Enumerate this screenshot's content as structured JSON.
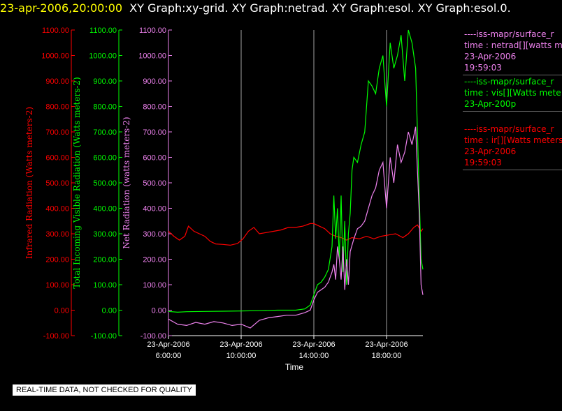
{
  "header": {
    "date_time": "23-apr-2006,20:00:00",
    "graphs": "XY Graph:xy-grid.  XY Graph:netrad.  XY Graph:esol.  XY Graph:esol.0."
  },
  "footer": {
    "disclaimer": "REAL-TIME DATA, NOT CHECKED FOR QUALITY"
  },
  "legend": [
    {
      "lines": [
        "----iss-mapr/surface_r",
        "time : netrad[][watts m",
        "23-Apr-2006",
        "19:59:03"
      ],
      "color": "#ee82ee"
    },
    {
      "lines": [
        "----iss-mapr/surface_r",
        "time : vis[][Watts mete",
        "23-Apr-200p"
      ],
      "color": "#00ff00"
    },
    {
      "lines": [
        "----iss-mapr/surface_r",
        "time : ir[][Watts meters",
        "23-Apr-2006",
        "19:59:03"
      ],
      "color": "#ff0000"
    }
  ],
  "chart_data": {
    "type": "line",
    "title": "",
    "xlabel": "Time",
    "x_ticks": [
      {
        "hour": 6,
        "line1": "23-Apr-2006",
        "line2": "6:00:00"
      },
      {
        "hour": 10,
        "line1": "23-Apr-2006",
        "line2": "10:00:00"
      },
      {
        "hour": 14,
        "line1": "23-Apr-2006",
        "line2": "14:00:00"
      },
      {
        "hour": 18,
        "line1": "23-Apr-2006",
        "line2": "18:00:00"
      }
    ],
    "x_range_hours": [
      6,
      20
    ],
    "y_axes": [
      {
        "id": "ir",
        "label": "Infrared Radiation (Watts meters-2)",
        "color": "#ff0000",
        "ylim": [
          -100,
          1100
        ]
      },
      {
        "id": "vis",
        "label": "Total Incoming Visible Radiation (Watts meters-2)",
        "color": "#00ff00",
        "ylim": [
          -100,
          1100
        ]
      },
      {
        "id": "net",
        "label": "Net Radiation (watts meters-2)",
        "color": "#ee82ee",
        "ylim": [
          -100,
          1100
        ]
      }
    ],
    "y_ticks": [
      "-100.00",
      "0.00",
      "100.00",
      "200.00",
      "300.00",
      "400.00",
      "500.00",
      "600.00",
      "700.00",
      "800.00",
      "900.00",
      "1000.00",
      "1100.00"
    ],
    "grid": "vertical",
    "series": [
      {
        "name": "ir",
        "color": "#ff0000",
        "x": [
          6.0,
          6.3,
          6.6,
          6.9,
          7.1,
          7.4,
          7.7,
          8.0,
          8.3,
          8.6,
          9.0,
          9.4,
          9.8,
          10.1,
          10.4,
          10.7,
          11.0,
          11.4,
          11.8,
          12.2,
          12.6,
          13.0,
          13.4,
          13.8,
          14.0,
          14.3,
          14.6,
          14.9,
          15.2,
          15.5,
          15.8,
          16.1,
          16.5,
          16.9,
          17.3,
          17.7,
          18.1,
          18.5,
          18.9,
          19.2,
          19.5,
          19.7,
          19.9,
          20.0
        ],
        "y": [
          310,
          290,
          275,
          290,
          330,
          310,
          300,
          290,
          270,
          260,
          258,
          255,
          262,
          280,
          310,
          325,
          300,
          305,
          310,
          315,
          325,
          325,
          330,
          340,
          340,
          330,
          320,
          300,
          290,
          285,
          275,
          285,
          280,
          290,
          280,
          290,
          295,
          300,
          285,
          300,
          325,
          335,
          310,
          320
        ]
      },
      {
        "name": "vis",
        "color": "#00ff00",
        "x": [
          6.0,
          6.5,
          7.0,
          8.0,
          9.0,
          10.0,
          11.0,
          12.0,
          13.0,
          13.5,
          13.8,
          14.0,
          14.2,
          14.4,
          14.6,
          14.8,
          15.0,
          15.1,
          15.2,
          15.3,
          15.4,
          15.5,
          15.6,
          15.7,
          15.8,
          15.9,
          16.0,
          16.1,
          16.2,
          16.4,
          16.6,
          16.8,
          17.0,
          17.2,
          17.4,
          17.6,
          17.8,
          18.0,
          18.2,
          18.4,
          18.6,
          18.8,
          19.0,
          19.2,
          19.4,
          19.6,
          19.8,
          19.9,
          20.0
        ],
        "y": [
          -5,
          -8,
          -6,
          -5,
          -4,
          -3,
          -2,
          0,
          0,
          5,
          20,
          60,
          100,
          110,
          130,
          160,
          250,
          450,
          280,
          400,
          200,
          450,
          150,
          350,
          100,
          300,
          380,
          550,
          600,
          580,
          650,
          700,
          900,
          880,
          850,
          950,
          1000,
          800,
          1050,
          950,
          1000,
          1080,
          900,
          1100,
          1050,
          950,
          450,
          200,
          160
        ]
      },
      {
        "name": "net",
        "color": "#ee82ee",
        "x": [
          6.0,
          6.5,
          7.0,
          7.5,
          8.0,
          8.5,
          9.0,
          9.5,
          10.0,
          10.5,
          11.0,
          11.5,
          12.0,
          12.5,
          13.0,
          13.5,
          13.8,
          14.0,
          14.2,
          14.4,
          14.6,
          14.8,
          15.0,
          15.1,
          15.2,
          15.3,
          15.4,
          15.5,
          15.6,
          15.7,
          15.8,
          15.9,
          16.0,
          16.2,
          16.4,
          16.6,
          16.8,
          17.0,
          17.2,
          17.4,
          17.6,
          17.8,
          18.0,
          18.2,
          18.4,
          18.6,
          18.8,
          19.0,
          19.2,
          19.4,
          19.6,
          19.8,
          19.9,
          20.0
        ],
        "y": [
          -35,
          -55,
          -60,
          -48,
          -55,
          -45,
          -50,
          -60,
          -55,
          -70,
          -40,
          -30,
          -25,
          -20,
          -20,
          -10,
          0,
          40,
          70,
          80,
          90,
          110,
          150,
          180,
          120,
          250,
          200,
          120,
          250,
          80,
          200,
          100,
          230,
          280,
          320,
          330,
          350,
          400,
          450,
          480,
          550,
          580,
          400,
          600,
          500,
          650,
          580,
          620,
          700,
          650,
          720,
          380,
          100,
          60
        ]
      }
    ]
  }
}
